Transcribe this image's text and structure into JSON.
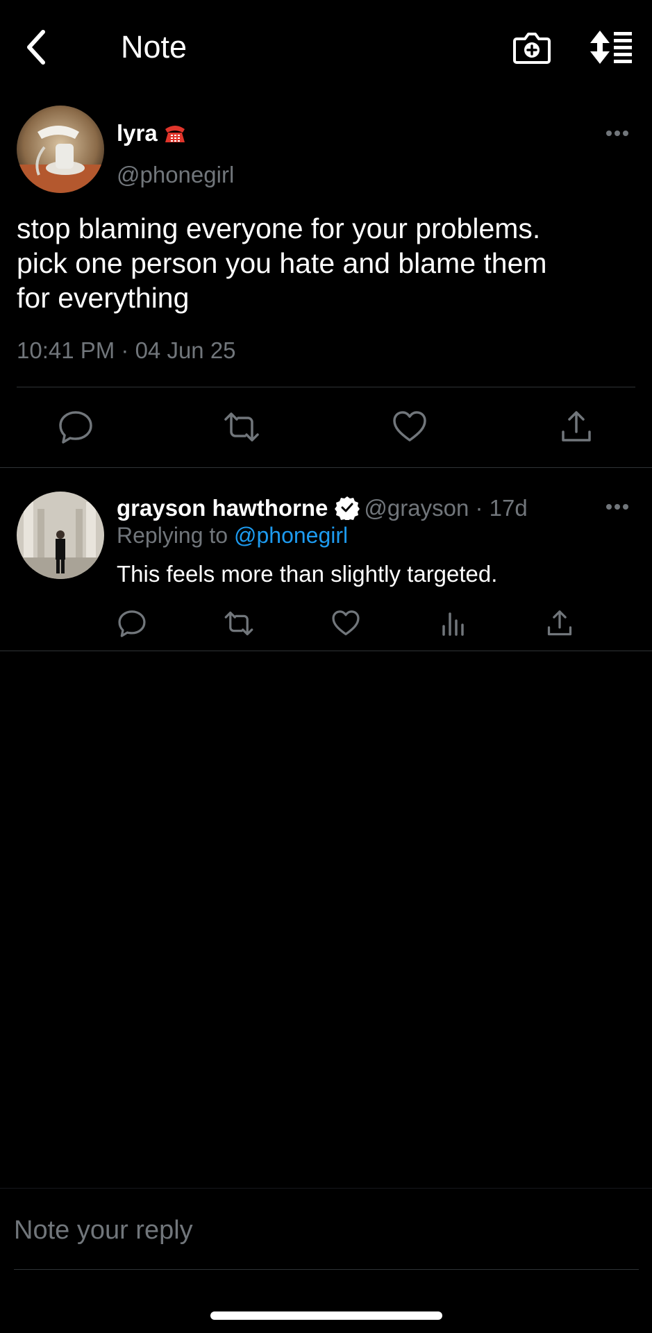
{
  "header": {
    "title": "Note",
    "back_icon": "chevron-left-icon",
    "camera_icon": "camera-add-icon",
    "sort_icon": "sort-list-icon"
  },
  "note": {
    "author_name": "lyra",
    "author_emoji": "telephone-emoji",
    "author_handle": "@phonegirl",
    "text": "stop blaming everyone for your problems.\npick one person you hate and blame them\nfor everything",
    "timestamp": "10:41 PM · 04 Jun 25",
    "actions": [
      "reply-icon",
      "repost-icon",
      "like-icon",
      "share-icon"
    ]
  },
  "reply": {
    "author_name": "grayson hawthorne",
    "verified": true,
    "author_handle": "@grayson",
    "age": "· 17d",
    "replying_prefix": "Replying to",
    "replying_to": "@phonegirl",
    "text": "This feels more than slightly targeted.",
    "actions": [
      "reply-icon",
      "repost-icon",
      "like-icon",
      "views-icon",
      "share-icon"
    ]
  },
  "composer": {
    "placeholder": "Note your reply"
  },
  "colors": {
    "background": "#000000",
    "text": "#ffffff",
    "muted": "#71767b",
    "accent": "#1d9bf0",
    "divider": "#2f3336"
  }
}
